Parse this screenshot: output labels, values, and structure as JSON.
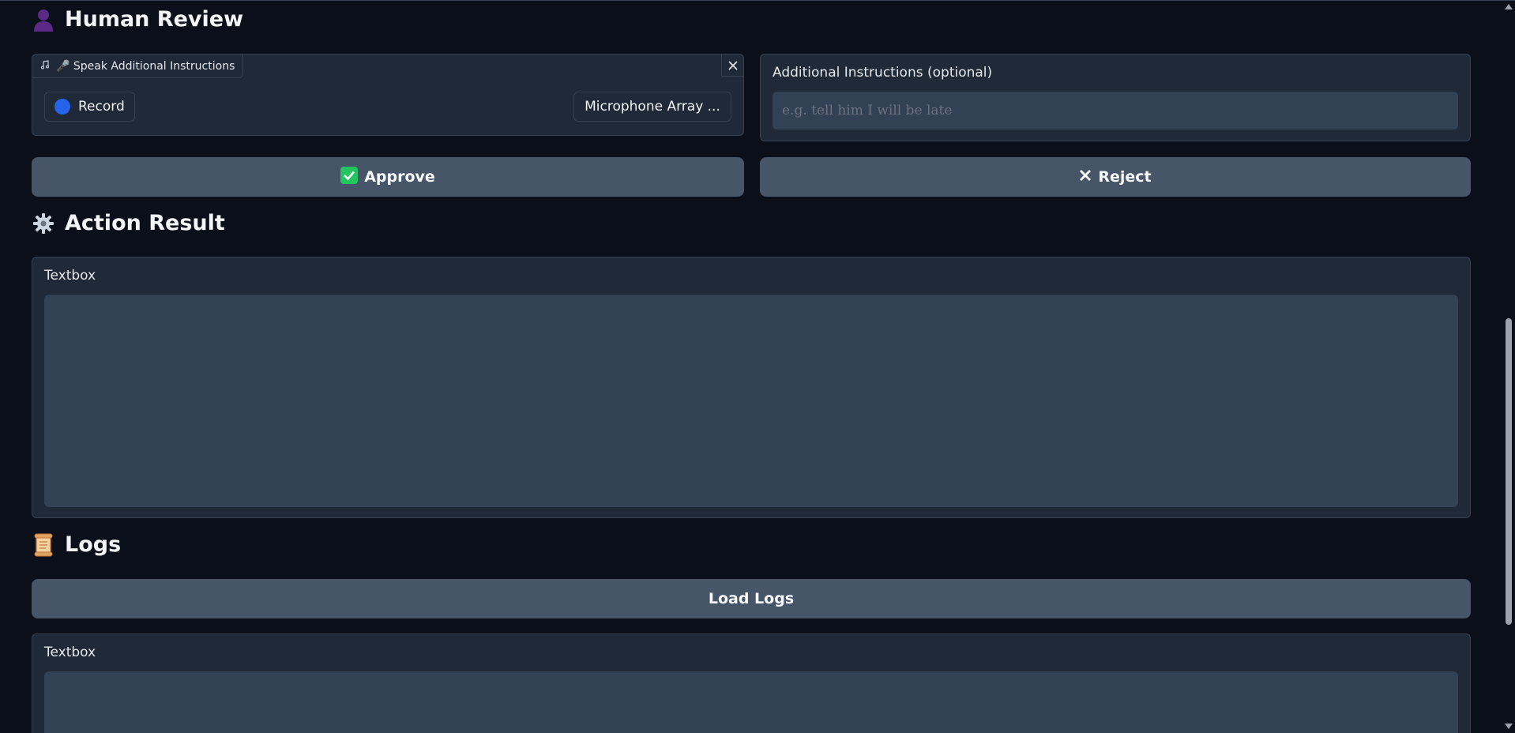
{
  "human_review": {
    "title": "Human Review",
    "title_icon": "person-silhouette-icon",
    "audio": {
      "tab_label": "🎤 Speak Additional Instructions",
      "record_label": "Record",
      "mic_label": "Microphone Array ..."
    },
    "instructions": {
      "label": "Additional Instructions (optional)",
      "placeholder": "e.g. tell him I will be late",
      "value": ""
    },
    "approve_label": "Approve",
    "reject_label": "Reject"
  },
  "action_result": {
    "title": "Action Result",
    "title_icon": "gear-icon",
    "textbox_label": "Textbox",
    "textbox_value": ""
  },
  "logs": {
    "title": "Logs",
    "title_icon": "scroll-icon",
    "load_label": "Load Logs",
    "textbox_label": "Textbox",
    "textbox_value": ""
  },
  "colors": {
    "background": "#0b0f19",
    "panel": "#1f2937",
    "button": "#475569",
    "input": "#334155",
    "record_dot": "#2563eb",
    "approve_check": "#22c55e"
  }
}
